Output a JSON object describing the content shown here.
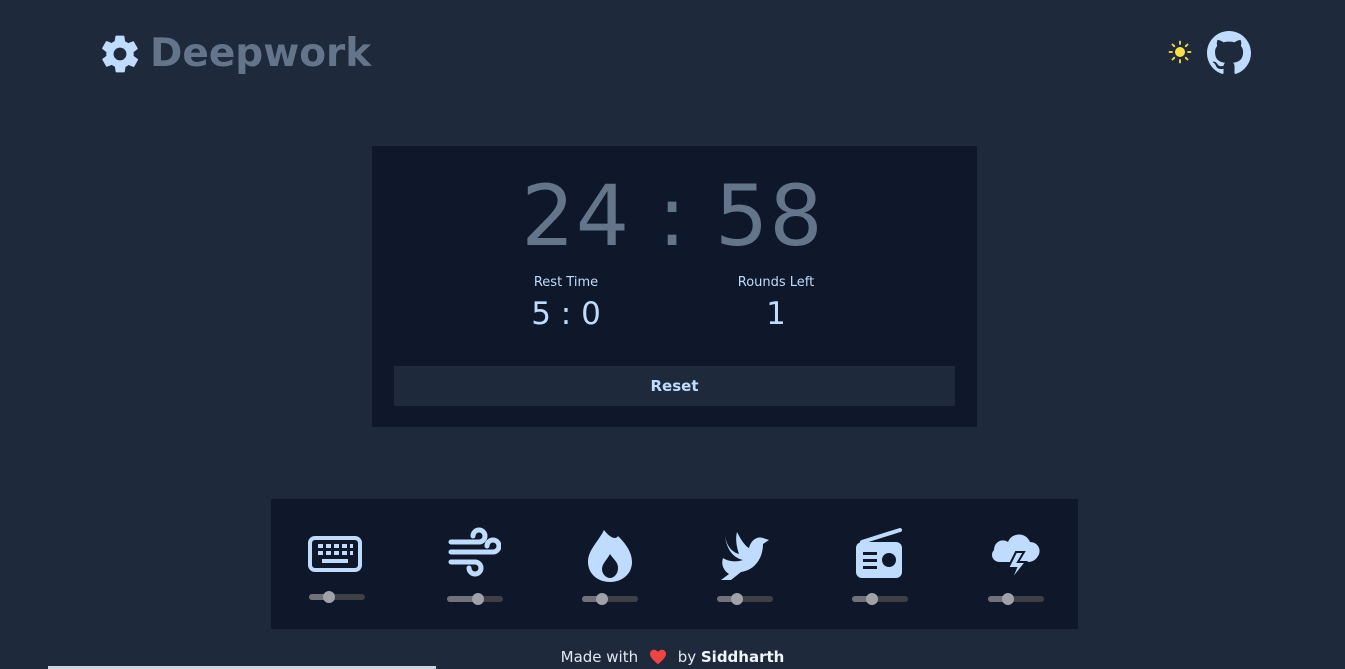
{
  "header": {
    "title": "Deepwork",
    "logo_icon": "gear-icon",
    "theme_icon": "sun-icon",
    "github_icon": "github-icon"
  },
  "timer": {
    "main_minutes": "24",
    "main_seconds": "58",
    "main_display": "24 : 58",
    "rest_label": "Rest Time",
    "rest_value": "5 : 0",
    "rounds_label": "Rounds Left",
    "rounds_value": "1",
    "reset_label": "Reset"
  },
  "sounds": [
    {
      "name": "keyboard",
      "icon": "keyboard-icon",
      "volume": 0.35
    },
    {
      "name": "wind",
      "icon": "wind-icon",
      "volume": 0.55
    },
    {
      "name": "fire",
      "icon": "fire-icon",
      "volume": 0.35
    },
    {
      "name": "birds",
      "icon": "dove-icon",
      "volume": 0.35
    },
    {
      "name": "radio",
      "icon": "radio-icon",
      "volume": 0.35
    },
    {
      "name": "storm",
      "icon": "thunderstorm-icon",
      "volume": 0.35
    }
  ],
  "footer": {
    "made_with": "Made with",
    "by": "by",
    "author": "Siddharth"
  },
  "colors": {
    "background": "#1e293b",
    "card": "#0f172a",
    "accent": "#bfdbfe",
    "muted": "#64748b",
    "heart": "#ef4444",
    "sun": "#fde047"
  }
}
